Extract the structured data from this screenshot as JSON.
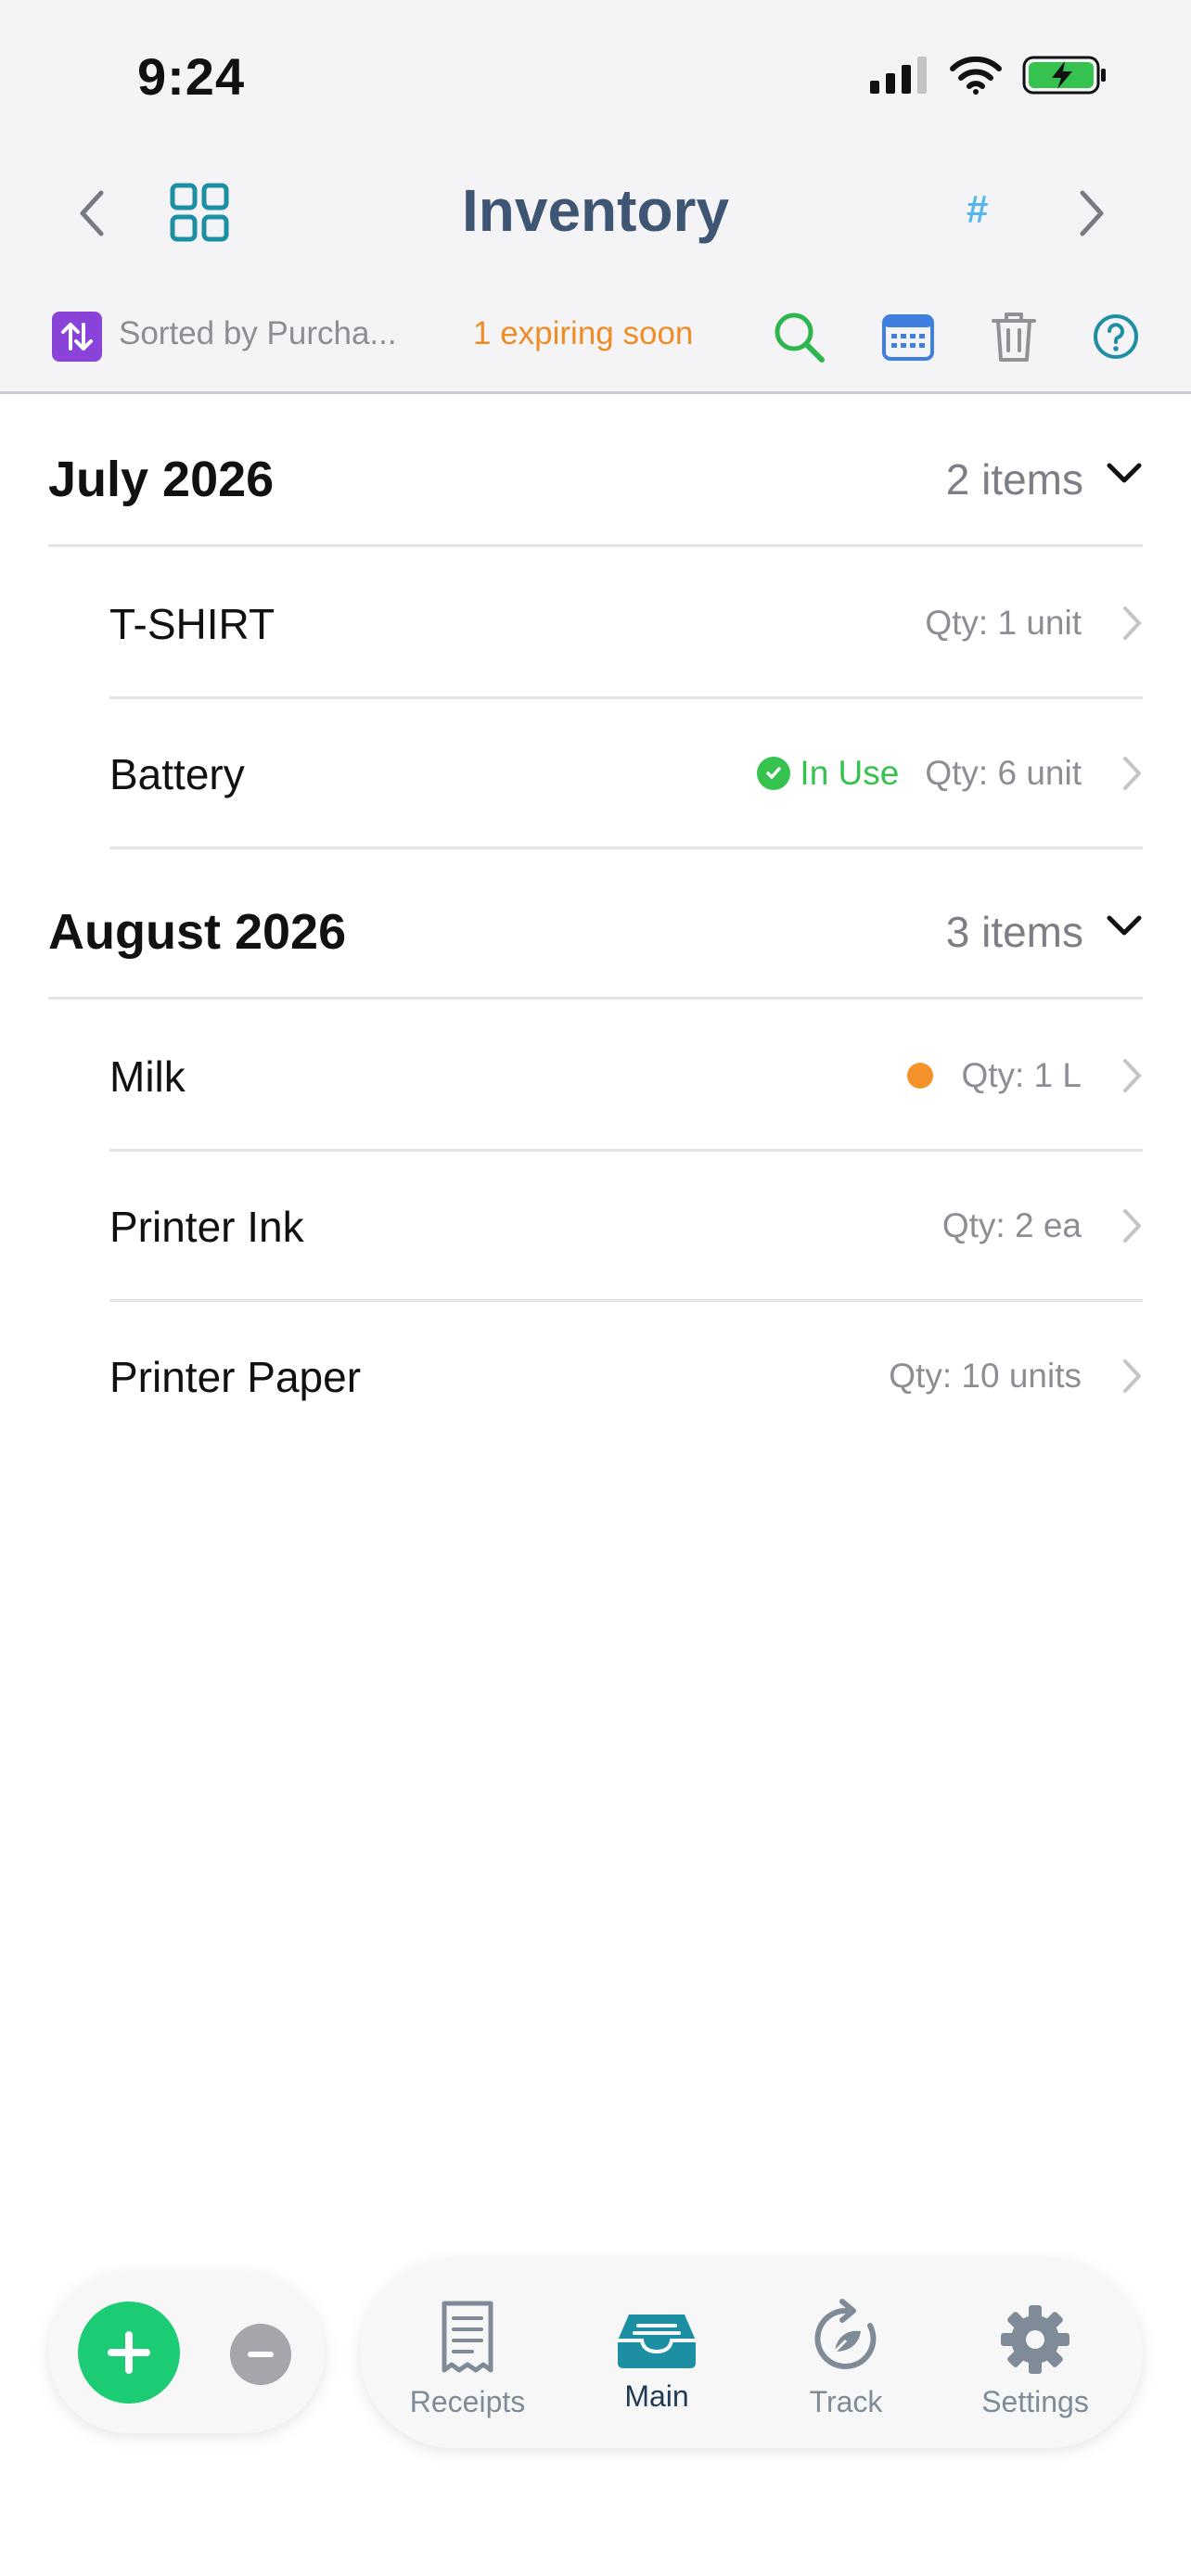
{
  "status_bar": {
    "time": "9:24"
  },
  "nav": {
    "title": "Inventory",
    "hash": "#"
  },
  "toolbar": {
    "sort_label": "Sorted by Purcha...",
    "expiring": "1 expiring soon"
  },
  "sections": [
    {
      "title": "July 2026",
      "count": "2 items",
      "items": [
        {
          "name": "T-SHIRT",
          "qty": "Qty: 1 unit"
        },
        {
          "name": "Battery",
          "status": "In Use",
          "qty": "Qty: 6 unit"
        }
      ]
    },
    {
      "title": "August 2026",
      "count": "3 items",
      "items": [
        {
          "name": "Milk",
          "qty": "Qty: 1 L",
          "indicator": "expiring-soon"
        },
        {
          "name": "Printer Ink",
          "qty": "Qty: 2 ea"
        },
        {
          "name": "Printer Paper",
          "qty": "Qty: 10 units"
        }
      ]
    }
  ],
  "tabs": [
    {
      "label": "Receipts",
      "icon": "receipt-icon"
    },
    {
      "label": "Main",
      "icon": "inbox-icon",
      "active": true
    },
    {
      "label": "Track",
      "icon": "track-icon"
    },
    {
      "label": "Settings",
      "icon": "gear-icon"
    }
  ],
  "colors": {
    "title": "#3e5674",
    "accent_green": "#1ccc75",
    "in_use_green": "#35c24f",
    "expiring_orange": "#f08c25",
    "sort_purple": "#8a43d8",
    "grid_teal": "#1d8fa3",
    "hash_blue": "#55b6ee"
  }
}
